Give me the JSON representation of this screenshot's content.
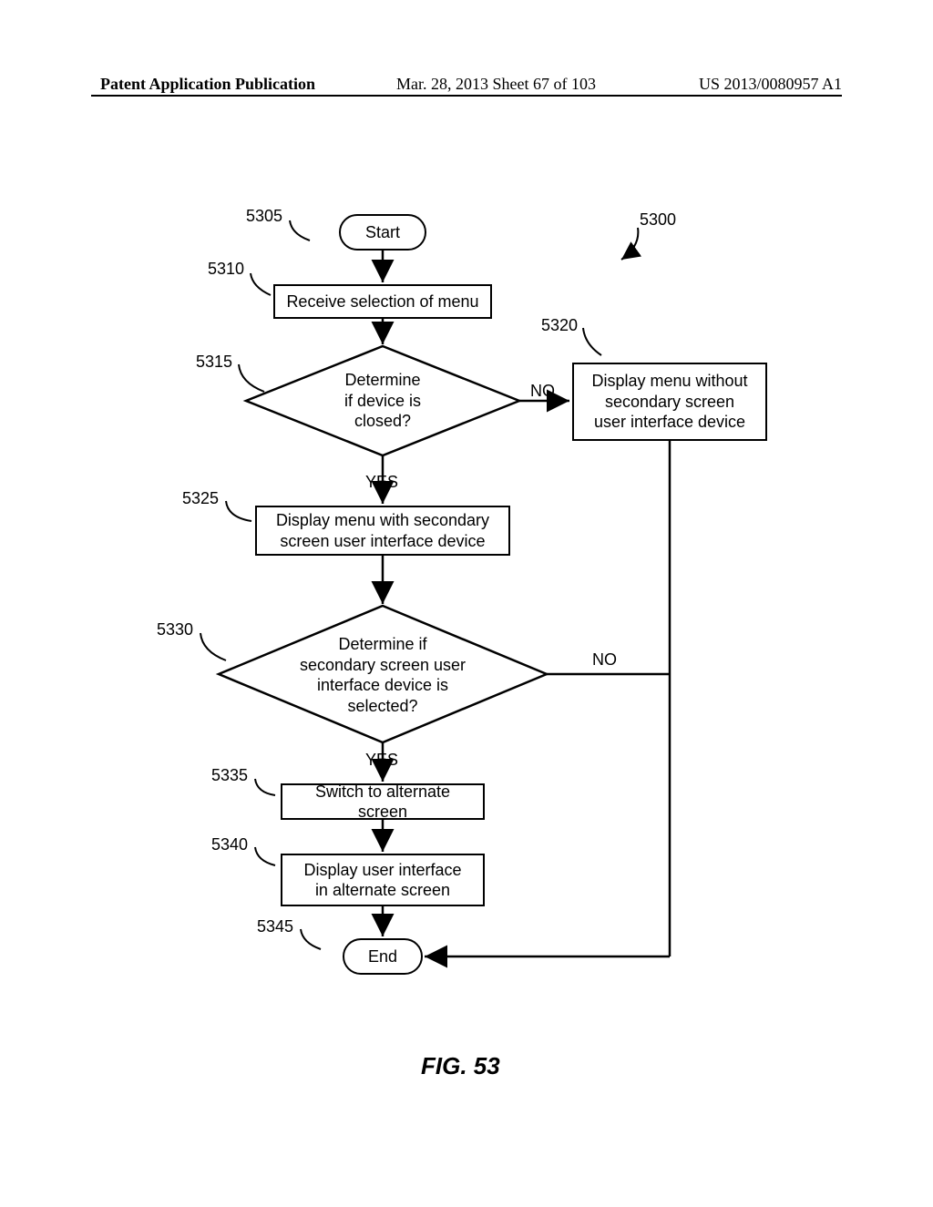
{
  "header": {
    "left": "Patent Application Publication",
    "mid": "Mar. 28, 2013  Sheet 67 of 103",
    "right": "US 2013/0080957 A1"
  },
  "refs": {
    "r5300": "5300",
    "r5305": "5305",
    "r5310": "5310",
    "r5315": "5315",
    "r5320": "5320",
    "r5325": "5325",
    "r5330": "5330",
    "r5335": "5335",
    "r5340": "5340",
    "r5345": "5345"
  },
  "nodes": {
    "start": "Start",
    "receive": "Receive selection of menu",
    "decide_closed": "Determine\nif device is\nclosed?",
    "disp_without": "Display menu without\nsecondary screen\nuser interface device",
    "disp_with": "Display menu with secondary\nscreen user interface device",
    "decide_selected": "Determine if\nsecondary screen user\ninterface device is\nselected?",
    "switch": "Switch to alternate screen",
    "disp_ui": "Display user interface\nin alternate screen",
    "end": "End"
  },
  "labels": {
    "yes": "YES",
    "no": "NO"
  },
  "figure": "FIG. 53"
}
